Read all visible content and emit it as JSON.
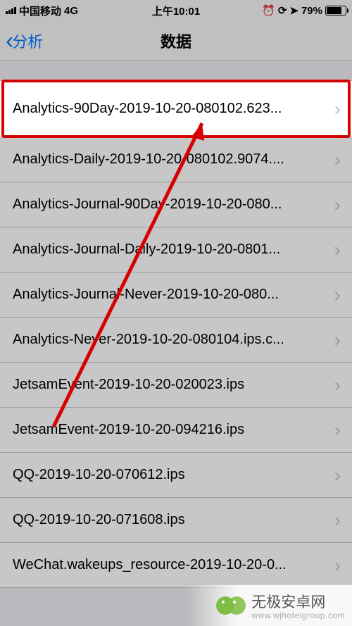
{
  "status": {
    "carrier": "中国移动",
    "network": "4G",
    "time": "上午10:01",
    "battery_pct": "79%",
    "battery_fill_pct": 79,
    "alarm_icon": "alarm-icon",
    "lock_icon": "lock-rotation-icon",
    "location_icon": "location-icon"
  },
  "nav": {
    "back_label": "分析",
    "title": "数据"
  },
  "list": {
    "items": [
      {
        "label": "Analytics-90Day-2019-10-20-080102.623...",
        "highlighted": true
      },
      {
        "label": "Analytics-Daily-2019-10-20-080102.9074...."
      },
      {
        "label": "Analytics-Journal-90Day-2019-10-20-080..."
      },
      {
        "label": "Analytics-Journal-Daily-2019-10-20-0801..."
      },
      {
        "label": "Analytics-Journal-Never-2019-10-20-080..."
      },
      {
        "label": "Analytics-Never-2019-10-20-080104.ips.c..."
      },
      {
        "label": "JetsamEvent-2019-10-20-020023.ips"
      },
      {
        "label": "JetsamEvent-2019-10-20-094216.ips"
      },
      {
        "label": "QQ-2019-10-20-070612.ips"
      },
      {
        "label": "QQ-2019-10-20-071608.ips"
      },
      {
        "label": "WeChat.wakeups_resource-2019-10-20-0..."
      }
    ]
  },
  "watermark": {
    "text": "无极安卓网",
    "sub": "www.wjhotelgroup.com"
  },
  "annotation_color": "#d70000"
}
